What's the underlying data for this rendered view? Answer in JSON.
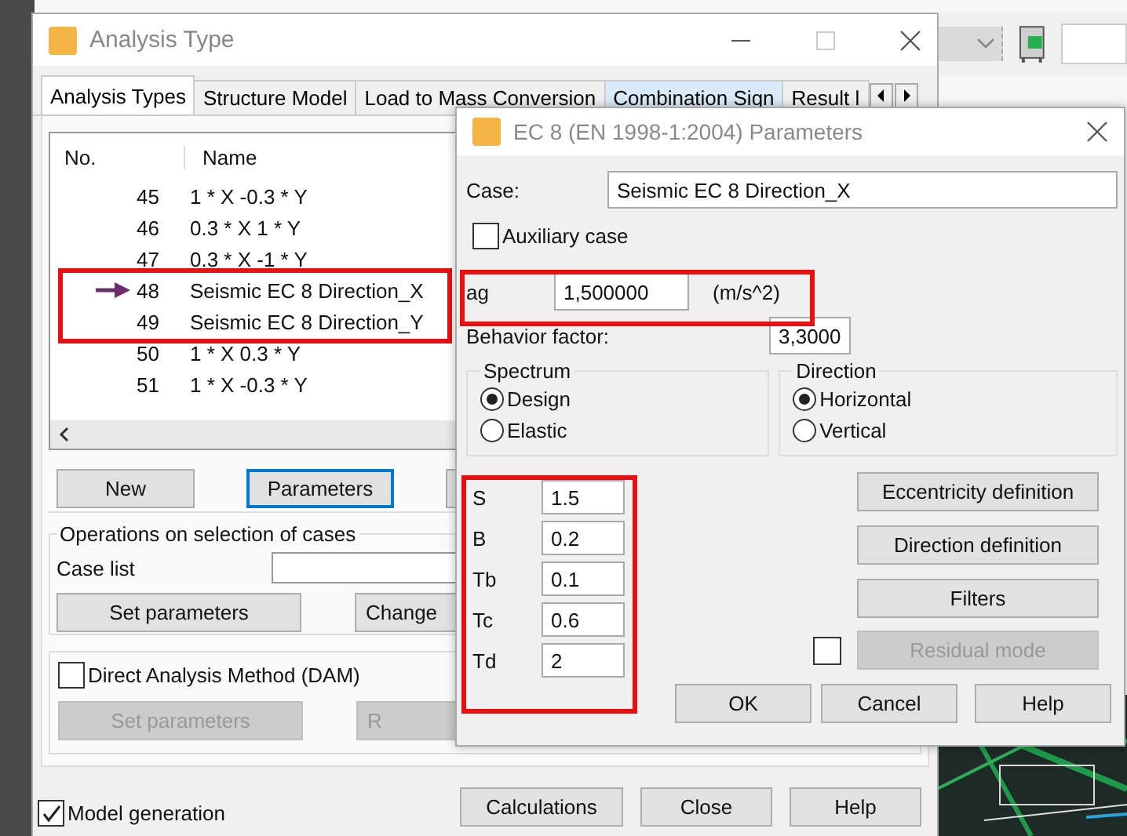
{
  "main_window": {
    "title": "Analysis Type",
    "tabs": [
      {
        "label": "Analysis Types",
        "selected": true,
        "hot": false
      },
      {
        "label": "Structure Model",
        "selected": false,
        "hot": false
      },
      {
        "label": "Load to Mass Conversion",
        "selected": false,
        "hot": false
      },
      {
        "label": "Combination Sign",
        "selected": false,
        "hot": true
      },
      {
        "label": "Result l",
        "selected": false,
        "hot": false
      }
    ],
    "table": {
      "columns": [
        "No.",
        "Name"
      ],
      "rows": [
        {
          "no": "45",
          "name": "1 * X  -0.3 * Y",
          "current": false
        },
        {
          "no": "46",
          "name": "0.3 * X  1 * Y",
          "current": false
        },
        {
          "no": "47",
          "name": "0.3 * X  -1 * Y",
          "current": false
        },
        {
          "no": "48",
          "name": "Seismic EC 8 Direction_X",
          "current": true
        },
        {
          "no": "49",
          "name": "Seismic EC 8 Direction_Y",
          "current": false
        },
        {
          "no": "50",
          "name": "1 * X  0.3 * Y",
          "current": false
        },
        {
          "no": "51",
          "name": "1 * X  -0.3 * Y",
          "current": false
        }
      ]
    },
    "buttons": [
      {
        "label": "New",
        "focused": false
      },
      {
        "label": "Parameters",
        "focused": true
      }
    ],
    "operations": {
      "title": "Operations on selection of cases",
      "case_list_label": "Case list",
      "buttons": [
        "Set parameters",
        "Change"
      ]
    },
    "dam": {
      "label": "Direct Analysis Method (DAM)",
      "checked": false,
      "buttons": [
        {
          "label": "Set parameters",
          "disabled": true
        },
        {
          "label": "R",
          "disabled": true
        }
      ]
    },
    "model_generation": {
      "label": "Model generation",
      "checked": true
    },
    "footer_buttons": [
      "Calculations",
      "Close",
      "Help"
    ]
  },
  "dialog": {
    "title": "EC 8 (EN 1998-1:2004) Parameters",
    "case": {
      "label": "Case:",
      "value": "Seismic EC 8 Direction_X"
    },
    "auxiliary": {
      "label": "Auxiliary case",
      "checked": false
    },
    "ag": {
      "label": "ag",
      "value": "1,500000",
      "unit": "(m/s^2)"
    },
    "behavior": {
      "label": "Behavior factor:",
      "value": "3,3000"
    },
    "spectrum": {
      "title": "Spectrum",
      "options": [
        {
          "label": "Design",
          "selected": true
        },
        {
          "label": "Elastic",
          "selected": false
        }
      ]
    },
    "direction": {
      "title": "Direction",
      "options": [
        {
          "label": "Horizontal",
          "selected": true
        },
        {
          "label": "Vertical",
          "selected": false
        }
      ]
    },
    "params": [
      {
        "label": "S",
        "value": "1.5"
      },
      {
        "label": "B",
        "value": "0.2"
      },
      {
        "label": "Tb",
        "value": "0.1"
      },
      {
        "label": "Tc",
        "value": "0.6"
      },
      {
        "label": "Td",
        "value": "2"
      }
    ],
    "side_buttons": [
      {
        "label": "Eccentricity definition",
        "disabled": false
      },
      {
        "label": "Direction definition",
        "disabled": false
      },
      {
        "label": "Filters",
        "disabled": false
      }
    ],
    "residual": {
      "label": "Residual mode",
      "checked": false,
      "disabled": true
    },
    "buttons": [
      "OK",
      "Cancel",
      "Help"
    ]
  }
}
